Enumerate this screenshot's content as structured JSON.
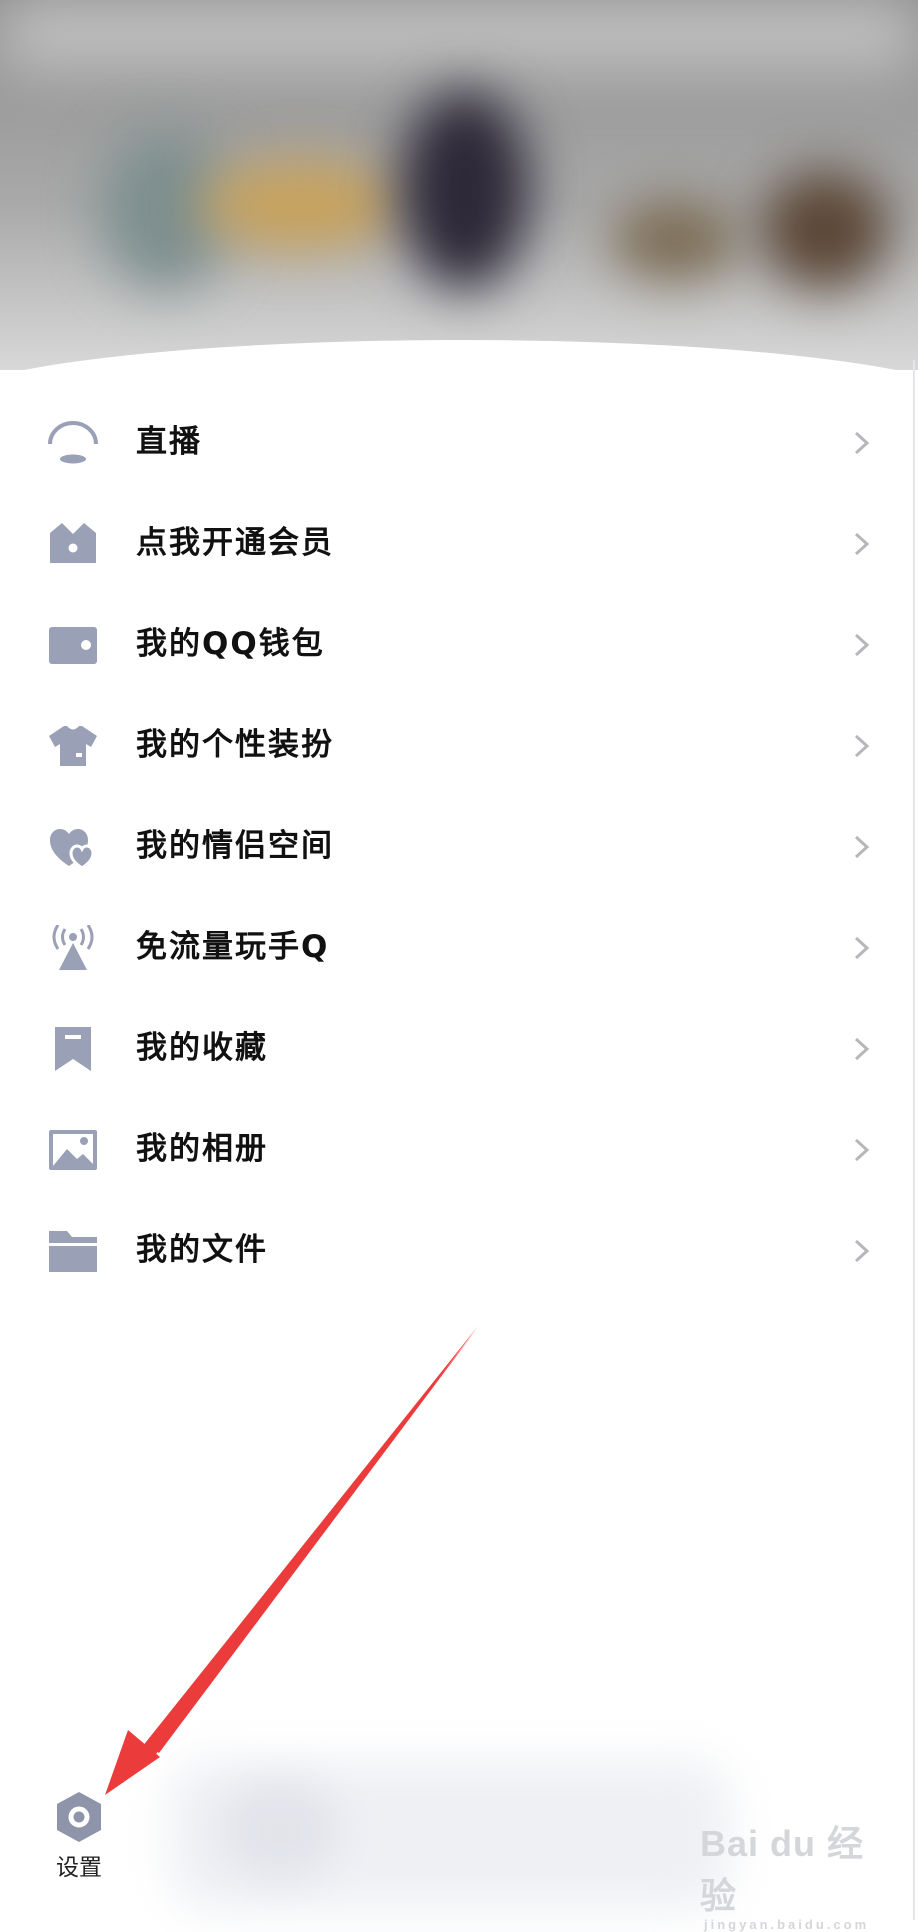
{
  "menu": {
    "items": [
      {
        "label": "直播",
        "icon": "live-icon"
      },
      {
        "label": "点我开通会员",
        "icon": "crown-icon"
      },
      {
        "label": "我的QQ钱包",
        "icon": "wallet-icon"
      },
      {
        "label": "我的个性装扮",
        "icon": "tshirt-icon"
      },
      {
        "label": "我的情侣空间",
        "icon": "hearts-icon"
      },
      {
        "label": "免流量玩手Q",
        "icon": "signal-tower-icon"
      },
      {
        "label": "我的收藏",
        "icon": "bookmark-icon"
      },
      {
        "label": "我的相册",
        "icon": "photo-album-icon"
      },
      {
        "label": "我的文件",
        "icon": "folder-icon"
      }
    ]
  },
  "footer": {
    "settings_label": "设置",
    "settings_icon": "settings-icon"
  },
  "watermark": {
    "brand": "Bai du 经验",
    "domain": "jingyan.baidu.com"
  },
  "colors": {
    "icon": "#9aa0b6",
    "text": "#111111",
    "chevron": "#b5b7bd",
    "annotation_arrow": "#ec3b3b"
  }
}
